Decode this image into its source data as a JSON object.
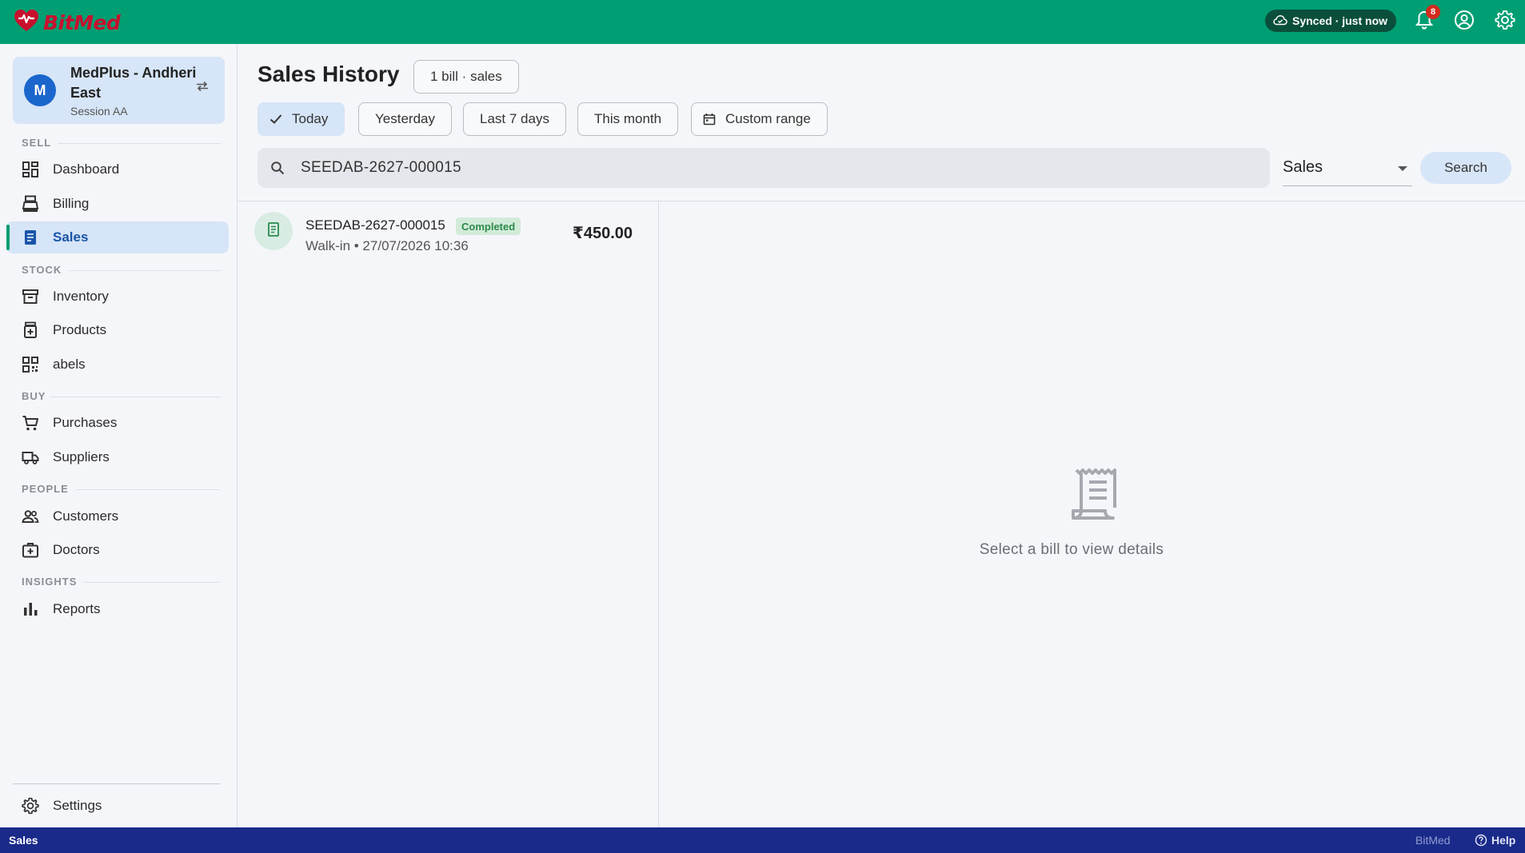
{
  "app": {
    "brand": "BitMed",
    "sync_status": "Synced · just now",
    "notifications_count": "8"
  },
  "sidebar": {
    "store": {
      "avatar_letter": "M",
      "name": "MedPlus - Andheri East",
      "session": "Session AA"
    },
    "sections": {
      "sell": "SELL",
      "stock": "STOCK",
      "buy": "BUY",
      "people": "PEOPLE",
      "insights": "INSIGHTS"
    },
    "items": {
      "dashboard": "Dashboard",
      "billing": "Billing",
      "sales": "Sales",
      "inventory": "Inventory",
      "products": "Products",
      "labels": "abels",
      "purchases": "Purchases",
      "suppliers": "Suppliers",
      "customers": "Customers",
      "doctors": "Doctors",
      "reports": "Reports",
      "settings": "Settings"
    },
    "active_item": "Sales"
  },
  "main": {
    "title": "Sales History",
    "count_chip": "1 bill · sales",
    "filters": {
      "today": "Today",
      "yesterday": "Yesterday",
      "last7": "Last 7 days",
      "this_month": "This month",
      "custom": "Custom range"
    },
    "selected_filter": "Today",
    "search": {
      "value": "SEEDAB-2627-000015",
      "type_selected": "Sales",
      "button": "Search"
    },
    "bills": [
      {
        "number": "SEEDAB-2627-000015",
        "status": "Completed",
        "meta": "Walk-in • 27/07/2026 10:36",
        "amount": "₹450.00"
      }
    ],
    "empty_detail": "Select a bill to view details"
  },
  "statusbar": {
    "page": "Sales",
    "brand": "BitMed",
    "help": "Help"
  },
  "colors": {
    "topbar": "#009e72",
    "accent_blue": "#1a66cc",
    "active_bg": "#d6e5f7",
    "statusbar": "#1a2a8a",
    "completed_badge": "#2b8a4a"
  }
}
